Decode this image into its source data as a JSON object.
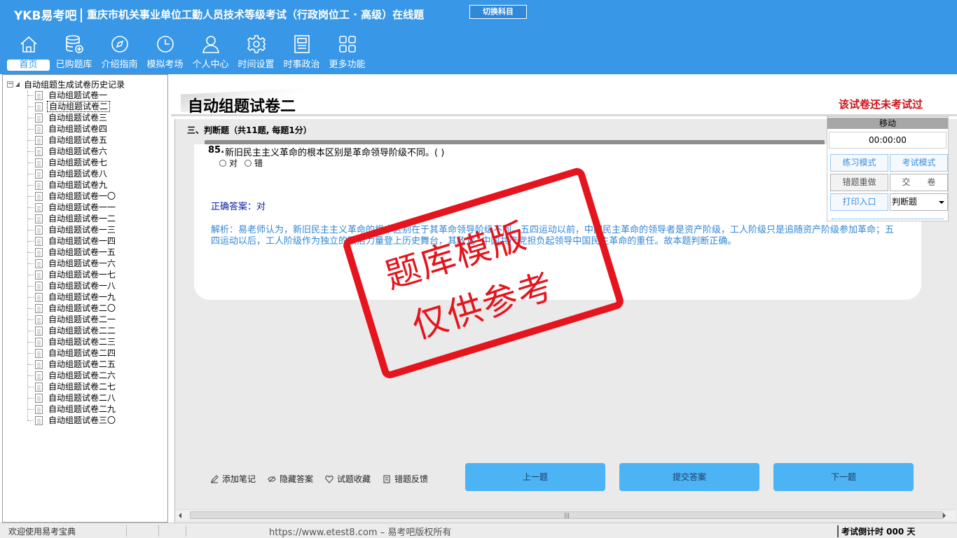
{
  "brand": "YKB易考吧",
  "exam_title": "重庆市机关事业单位工勤人员技术等级考试（行政岗位工 · 高级）在线题",
  "switch_subject": "切换科目",
  "nav": [
    {
      "label": "首页",
      "icon": "home-icon"
    },
    {
      "label": "已购题库",
      "icon": "database-icon"
    },
    {
      "label": "介绍指南",
      "icon": "compass-icon"
    },
    {
      "label": "模拟考场",
      "icon": "clock-icon"
    },
    {
      "label": "个人中心",
      "icon": "user-icon"
    },
    {
      "label": "时间设置",
      "icon": "gear-icon"
    },
    {
      "label": "时事政治",
      "icon": "news-icon"
    },
    {
      "label": "更多功能",
      "icon": "grid-icon"
    }
  ],
  "tree": {
    "root": "自动组题生成试卷历史记录",
    "items": [
      "自动组题试卷一",
      "自动组题试卷二",
      "自动组题试卷三",
      "自动组题试卷四",
      "自动组题试卷五",
      "自动组题试卷六",
      "自动组题试卷七",
      "自动组题试卷八",
      "自动组题试卷九",
      "自动组题试卷一〇",
      "自动组题试卷一一",
      "自动组题试卷一二",
      "自动组题试卷一三",
      "自动组题试卷一四",
      "自动组题试卷一五",
      "自动组题试卷一六",
      "自动组题试卷一七",
      "自动组题试卷一八",
      "自动组题试卷一九",
      "自动组题试卷二〇",
      "自动组题试卷二一",
      "自动组题试卷二二",
      "自动组题试卷二三",
      "自动组题试卷二四",
      "自动组题试卷二五",
      "自动组题试卷二六",
      "自动组题试卷二七",
      "自动组题试卷二八",
      "自动组题试卷二九",
      "自动组题试卷三〇"
    ],
    "selected_index": 1
  },
  "paper": {
    "title": "自动组题试卷二",
    "status": "该试卷还未考试过"
  },
  "section": {
    "title": "三、判断题（共11题, 每题1分）"
  },
  "question": {
    "number": "85.",
    "text": "新旧民主主义革命的根本区别是革命领导阶级不同。( )",
    "options": [
      "对",
      "错"
    ],
    "answer": "正确答案：对",
    "analysis": "解析：易老师认为，新旧民主主义革命的根本区别在于其革命领导阶级不同。五四运动以前，中国民主革命的领导者是资产阶级，工人阶级只是追随资产阶级参加革命；五四运动以后，工人阶级作为独立的政治力量登上历史舞台，其政党--中国共产党担负起领导中国民主革命的重任。故本题判断正确。"
  },
  "watermark": {
    "line1": "题库模版",
    "line2": "仅供参考"
  },
  "float_panel": {
    "move": "移动",
    "timer": "00:00:00",
    "practice_mode": "练习模式",
    "exam_mode": "考试模式",
    "redo_wrong": "错题重做",
    "submit_paper": "交　　卷",
    "print": "打印入口",
    "type_select": "判断题"
  },
  "tools": {
    "add_note": "添加笔记",
    "hide_answer": "隐藏答案",
    "favorite": "试题收藏",
    "feedback": "错题反馈"
  },
  "buttons": {
    "prev": "上一题",
    "submit": "提交答案",
    "next": "下一题"
  },
  "statusbar": {
    "welcome": "欢迎使用易考宝典",
    "copyright": "https://www.etest8.com – 易考吧版权所有",
    "countdown": "考试倒计时 000 天"
  },
  "colors": {
    "header_bg": "#3897e6",
    "stamp_red": "#e5141d",
    "status_red": "#c8141a",
    "button_blue": "#4cb4f4"
  }
}
